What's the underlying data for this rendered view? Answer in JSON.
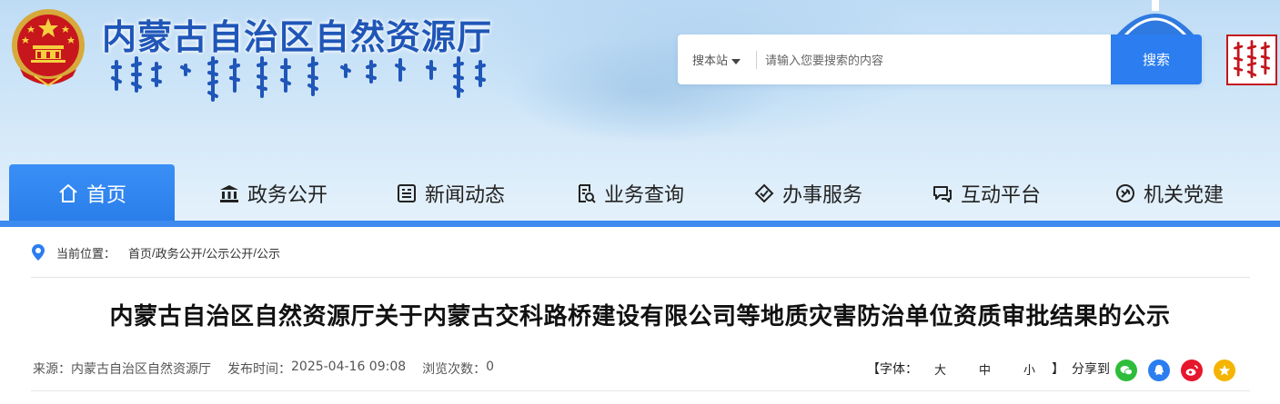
{
  "header": {
    "site_title": "内蒙古自治区自然资源厅",
    "search": {
      "scope_label": "搜本站",
      "placeholder": "请输入您要搜索的内容",
      "button_label": "搜索"
    }
  },
  "nav": {
    "items": [
      {
        "label": "首页",
        "icon": "home-icon",
        "active": true
      },
      {
        "label": "政务公开",
        "icon": "government-building-icon"
      },
      {
        "label": "新闻动态",
        "icon": "news-icon"
      },
      {
        "label": "业务查询",
        "icon": "document-search-icon"
      },
      {
        "label": "办事服务",
        "icon": "service-diamond-icon"
      },
      {
        "label": "互动平台",
        "icon": "chat-bubbles-icon"
      },
      {
        "label": "机关党建",
        "icon": "party-emblem-icon"
      }
    ]
  },
  "breadcrumb": {
    "label": "当前位置：",
    "items": [
      "首页",
      "政务公开",
      "公示公开",
      "公示"
    ],
    "separator": "/"
  },
  "article": {
    "title": "内蒙古自治区自然资源厅关于内蒙古交科路桥建设有限公司等地质灾害防治单位资质审批结果的公示",
    "source_label": "来源：",
    "source": "内蒙古自治区自然资源厅",
    "published_label": "发布时间：",
    "published": "2025-04-16 09:08",
    "views_label": "浏览次数：",
    "views": "0"
  },
  "font_control": {
    "open_bracket": "【字体：",
    "large": "大",
    "medium": "中",
    "small": "小",
    "close_bracket": "】",
    "share_label": "分享到"
  },
  "share": [
    {
      "icon": "wechat-icon",
      "color": "#2dbd3a"
    },
    {
      "icon": "qq-icon",
      "color": "#2b7df0"
    },
    {
      "icon": "weibo-icon",
      "color": "#e6162d"
    },
    {
      "icon": "qzone-icon",
      "color": "#f5b400"
    }
  ],
  "colors": {
    "brand_blue": "#1f56b8",
    "accent_blue": "#2b7df0",
    "seal_red": "#c4161c"
  }
}
